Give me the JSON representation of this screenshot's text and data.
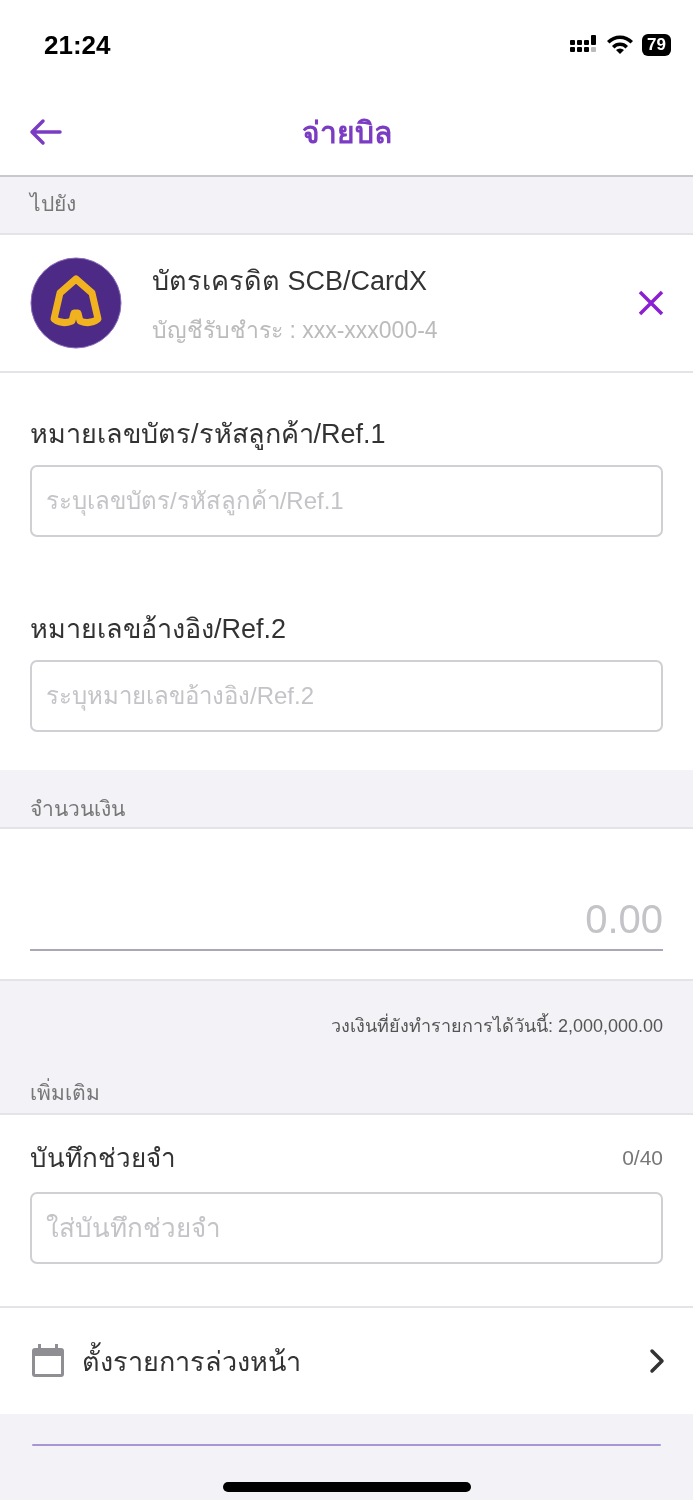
{
  "status_bar": {
    "time": "21:24",
    "battery": "79"
  },
  "nav": {
    "title": "จ่ายบิล"
  },
  "to_section": {
    "header": "ไปยัง",
    "biller": {
      "name": "บัตรเครดิต SCB/CardX",
      "account": "บัญชีรับชำระ : xxx-xxx000-4"
    }
  },
  "fields": [
    {
      "label": "หมายเลขบัตร/รหัสลูกค้า/Ref.1",
      "placeholder": "ระบุเลขบัตร/รหัสลูกค้า/Ref.1"
    },
    {
      "label": "หมายเลขอ้างอิง/Ref.2",
      "placeholder": "ระบุหมายเลขอ้างอิง/Ref.2"
    }
  ],
  "amount": {
    "header": "จำนวนเงิน",
    "placeholder": "0.00",
    "limit": "วงเงินที่ยังทำรายการได้วันนี้: 2,000,000.00"
  },
  "more": {
    "header": "เพิ่มเติม",
    "memo": {
      "label": "บันทึกช่วยจำ",
      "counter": "0/40",
      "placeholder": "ใส่บันทึกช่วยจำ"
    },
    "schedule": {
      "label": "ตั้งรายการล่วงหน้า"
    }
  }
}
